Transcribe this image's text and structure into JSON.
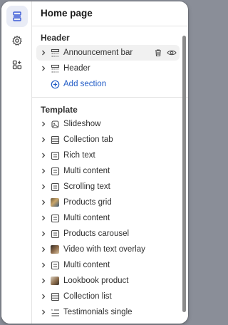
{
  "panel": {
    "title": "Home page"
  },
  "header_section": {
    "title": "Header",
    "items": [
      {
        "label": "Announcement bar"
      },
      {
        "label": "Header"
      }
    ],
    "add_label": "Add section"
  },
  "template_section": {
    "title": "Template",
    "items": [
      {
        "label": "Slideshow"
      },
      {
        "label": "Collection tab"
      },
      {
        "label": "Rich text"
      },
      {
        "label": "Multi content"
      },
      {
        "label": "Scrolling text"
      },
      {
        "label": "Products grid"
      },
      {
        "label": "Multi content"
      },
      {
        "label": "Products carousel"
      },
      {
        "label": "Video with text overlay"
      },
      {
        "label": "Multi content"
      },
      {
        "label": "Lookbook product"
      },
      {
        "label": "Collection list"
      },
      {
        "label": "Testimonials single"
      }
    ]
  },
  "colors": {
    "accent": "#1f5ac6",
    "selected_bg": "#f1f1f1",
    "rail_active": "#e9ecf6"
  }
}
